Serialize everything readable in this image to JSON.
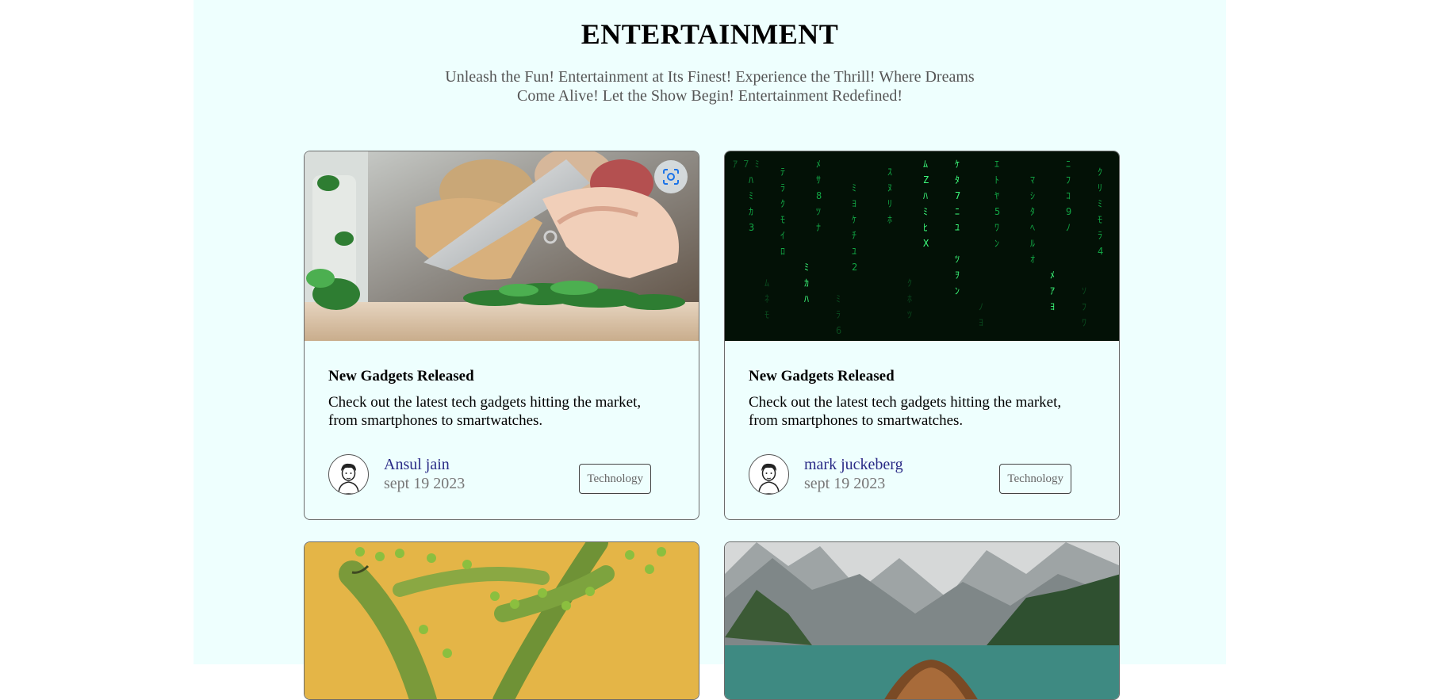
{
  "header": {
    "title": "ENTERTAINMENT",
    "subtitle": "Unleash the Fun! Entertainment at Its Finest! Experience the Thrill! Where Dreams Come Alive! Let the Show Begin! Entertainment Redefined!"
  },
  "cards": [
    {
      "image": "herbs-chopping-photo",
      "title": "New Gadgets Released",
      "text": "Check out the latest tech gadgets hitting the market, from smartphones to smartwatches.",
      "author": "Ansul jain",
      "date": "sept 19 2023",
      "tag": "Technology"
    },
    {
      "image": "matrix-code-photo",
      "title": "New Gadgets Released",
      "text": "Check out the latest tech gadgets hitting the market, from smartphones to smartwatches.",
      "author": "mark juckeberg",
      "date": "sept 19 2023",
      "tag": "Technology"
    },
    {
      "image": "green-peas-photo"
    },
    {
      "image": "mountain-lake-boat-photo"
    }
  ],
  "colors": {
    "page_background": "#eefffe",
    "author_name": "#2a2a86",
    "lens_icon": "#1a73e8"
  }
}
